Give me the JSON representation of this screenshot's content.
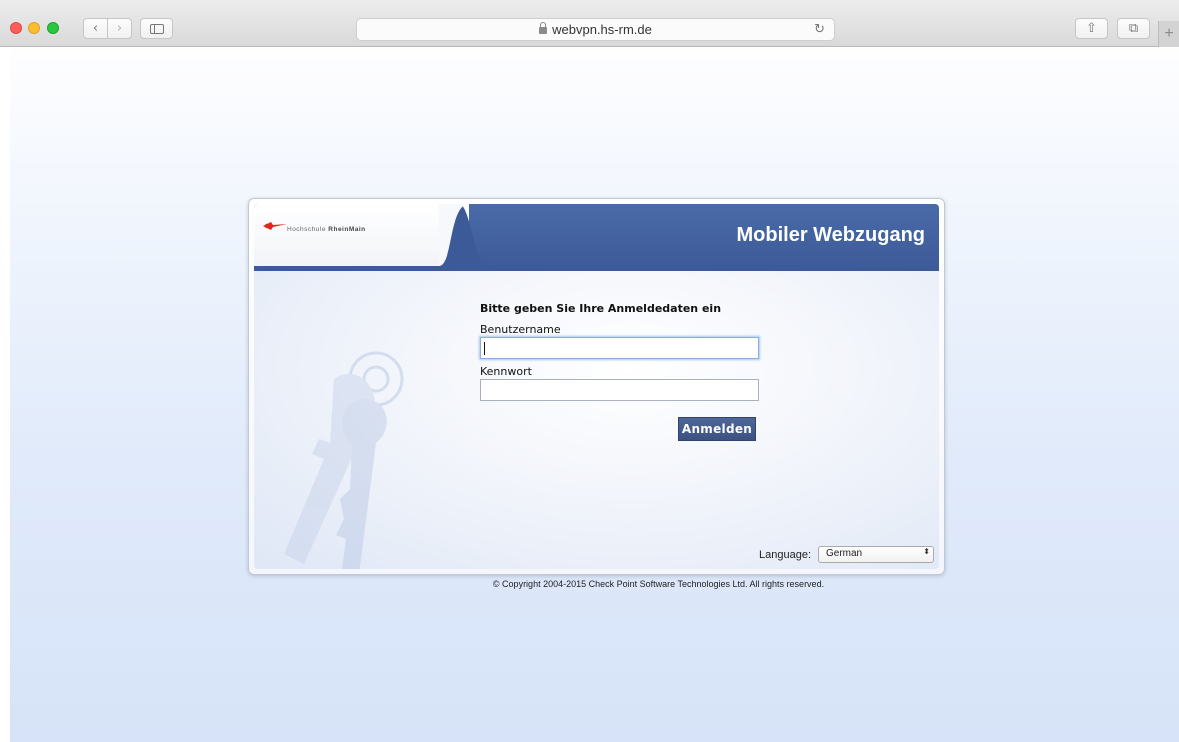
{
  "browser": {
    "url": "webvpn.hs-rm.de",
    "back_glyph": "‹",
    "forward_glyph": "›",
    "reload_glyph": "↻",
    "share_glyph": "⇧",
    "tabs_glyph": "⧉",
    "newtab_glyph": "+"
  },
  "header": {
    "logo_text_light": "Hochschule ",
    "logo_text_bold": "RheinMain",
    "title": "Mobiler Webzugang"
  },
  "form": {
    "prompt": "Bitte geben Sie Ihre Anmeldedaten ein",
    "username_label": "Benutzername",
    "username_value": "",
    "password_label": "Kennwort",
    "password_value": "",
    "submit_label": "Anmelden"
  },
  "language": {
    "label": "Language:",
    "selected": "German",
    "arrow": "⬍"
  },
  "footer": {
    "copyright": "© Copyright 2004-2015   Check Point Software Technologies Ltd. All rights reserved."
  },
  "colors": {
    "header_blue": "#3c5a97",
    "button_blue": "#3b5283",
    "logo_red": "#e0281c"
  }
}
